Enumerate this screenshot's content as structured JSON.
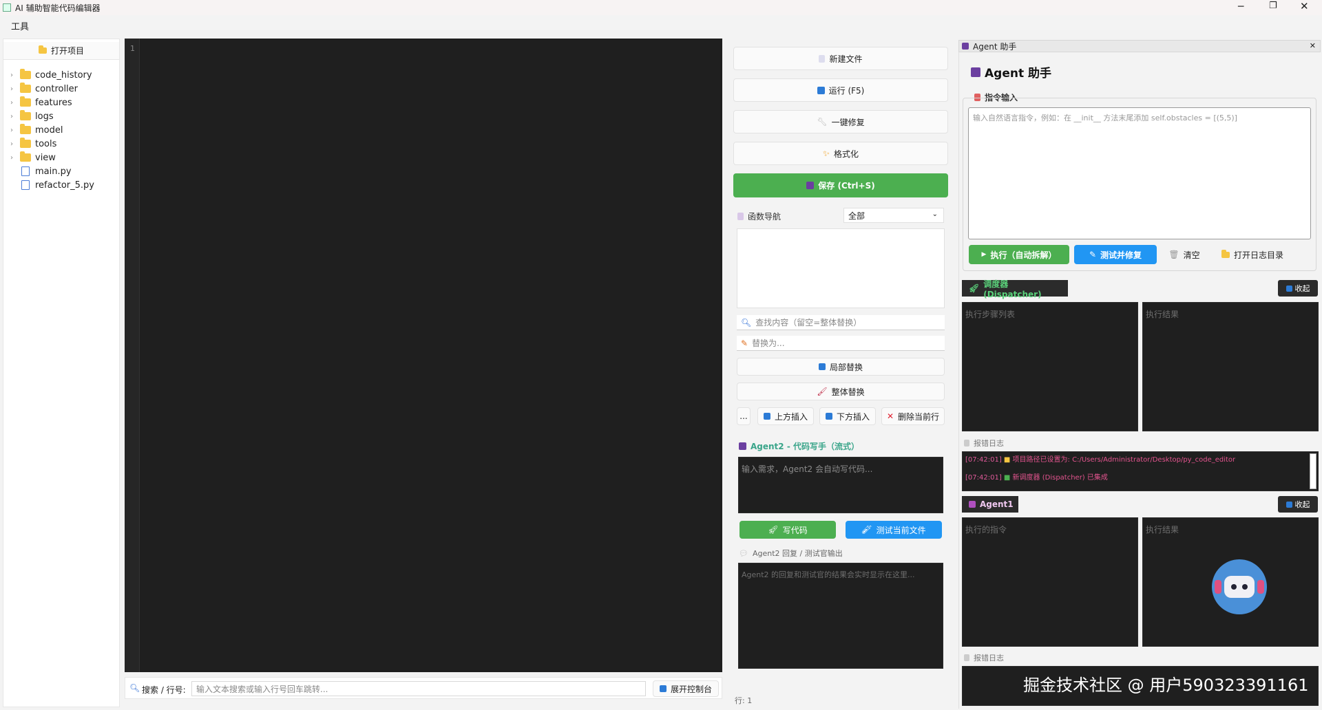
{
  "window": {
    "title": "AI 辅助智能代码编辑器"
  },
  "menu": {
    "tools": "工具"
  },
  "sidebar": {
    "open_project": "打开项目",
    "tree": [
      {
        "name": "code_history",
        "type": "folder"
      },
      {
        "name": "controller",
        "type": "folder"
      },
      {
        "name": "features",
        "type": "folder"
      },
      {
        "name": "logs",
        "type": "folder"
      },
      {
        "name": "model",
        "type": "folder"
      },
      {
        "name": "tools",
        "type": "folder"
      },
      {
        "name": "view",
        "type": "folder"
      },
      {
        "name": "main.py",
        "type": "file"
      },
      {
        "name": "refactor_5.py",
        "type": "file"
      }
    ]
  },
  "editor": {
    "line_number": "1"
  },
  "bottom_bar": {
    "search_label": "搜索 / 行号:",
    "search_placeholder": "输入文本搜索或输入行号回车跳转...",
    "expand_console": "展开控制台",
    "line_status": "行: 1"
  },
  "actions": {
    "new_file": "新建文件",
    "run": "运行 (F5)",
    "one_click_fix": "一键修复",
    "format": "格式化",
    "save": "保存 (Ctrl+S)"
  },
  "func_nav": {
    "label": "函数导航",
    "selected": "全部"
  },
  "replace": {
    "find_placeholder": "查找内容（留空=整体替换）",
    "replace_placeholder": "替换为...",
    "local_replace": "局部替换",
    "global_replace": "整体替换"
  },
  "line_ops": {
    "more": "...",
    "insert_above": "上方插入",
    "insert_below": "下方插入",
    "delete_line": "删除当前行"
  },
  "agent2": {
    "title": "Agent2 - 代码写手（流式）",
    "input_placeholder": "输入需求，Agent2 会自动写代码...",
    "write_code": "写代码",
    "test_file": "测试当前文件",
    "output_label": "Agent2 回复 / 测试官输出",
    "output_placeholder": "Agent2 的回复和测试官的结果会实时显示在这里..."
  },
  "agent_panel": {
    "tab_title": "Agent 助手",
    "heading": "Agent 助手",
    "instruction_label": "指令输入",
    "instruction_placeholder": "输入自然语言指令，例如：在 __init__ 方法末尾添加 self.obstacles = [(5,5)]",
    "execute": "执行（自动拆解）",
    "test_fix": "测试并修复",
    "clear": "清空",
    "open_log_dir": "打开日志目录"
  },
  "dispatcher": {
    "title": "调度器 (Dispatcher)",
    "collapse": "收起",
    "steps_label": "执行步骤列表",
    "results_label": "执行结果",
    "log_label": "报错日志",
    "log_lines": [
      {
        "time": "[07:42:01]",
        "text": "项目路径已设置为: C:/Users/Administrator/Desktop/py_code_editor"
      },
      {
        "time": "[07:42:01]",
        "text": "新调度器 (Dispatcher) 已集成"
      }
    ]
  },
  "agent1": {
    "title": "Agent1",
    "collapse": "收起",
    "instruction_label": "执行的指令",
    "results_label": "执行结果",
    "log_label": "报错日志"
  },
  "watermark": "掘金技术社区 @ 用户590323391161",
  "colors": {
    "green": "#4caf50",
    "blue": "#2196f3",
    "teal": "#3aa58a",
    "dark": "#1f1f1f"
  }
}
